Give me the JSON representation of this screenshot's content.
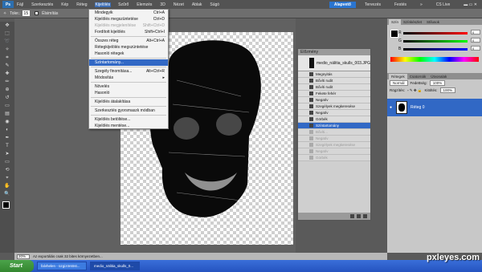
{
  "app": {
    "logo": "Ps"
  },
  "menubar": {
    "items": [
      "Fájl",
      "Szerkesztés",
      "Kép",
      "Réteg",
      "Kijelölés",
      "Szűrő",
      "Elemzés",
      "3D",
      "Nézet",
      "Ablak",
      "Súgó"
    ],
    "workspaces": [
      "Alapvető",
      "Tervezés",
      "Festés",
      "»"
    ],
    "cslive": "CS Live"
  },
  "options": {
    "tolerance_label": "Toler.:",
    "tolerance_value": "15",
    "smooth_label": "Élsimítás"
  },
  "dropdown": {
    "items": [
      {
        "label": "Mindegyik",
        "shortcut": "Ctrl+A",
        "disabled": false
      },
      {
        "label": "Kijelölés megszüntetése",
        "shortcut": "Ctrl+D",
        "disabled": false
      },
      {
        "label": "Kijelölés megjelenítése",
        "shortcut": "Shift+Ctrl+D",
        "disabled": true
      },
      {
        "label": "Fordított kijelölés",
        "shortcut": "Shift+Ctrl+I",
        "disabled": false
      },
      {
        "sep": true
      },
      {
        "label": "Összes réteg",
        "shortcut": "Alt+Ctrl+A",
        "disabled": false
      },
      {
        "label": "Rétegkijelölés megszüntetése",
        "shortcut": "",
        "disabled": false
      },
      {
        "label": "Hasonló rétegek",
        "shortcut": "",
        "disabled": false
      },
      {
        "sep": true
      },
      {
        "label": "Színtartomány...",
        "shortcut": "",
        "disabled": false,
        "selected": true
      },
      {
        "sep": true
      },
      {
        "label": "Szegély finomítása...",
        "shortcut": "Alt+Ctrl+R",
        "disabled": false
      },
      {
        "label": "Módosítás",
        "shortcut": "▸",
        "disabled": false
      },
      {
        "sep": true
      },
      {
        "label": "Növelés",
        "shortcut": "",
        "disabled": false
      },
      {
        "label": "Hasonló",
        "shortcut": "",
        "disabled": false
      },
      {
        "sep": true
      },
      {
        "label": "Kijelölés átalakítása",
        "shortcut": "",
        "disabled": false
      },
      {
        "sep": true
      },
      {
        "label": "Szerkesztés gyorsmaszk módban",
        "shortcut": "",
        "disabled": false
      },
      {
        "sep": true
      },
      {
        "label": "Kijelölés betöltése...",
        "shortcut": "",
        "disabled": false
      },
      {
        "label": "Kijelölés mentése...",
        "shortcut": "",
        "disabled": false
      }
    ]
  },
  "history": {
    "title": "Előzmény",
    "snapshot": "medio_nälitia_skulls_003.JPG",
    "rows": [
      {
        "label": "Megnyitás",
        "state": "done"
      },
      {
        "label": "Bővíti rudit",
        "state": "done"
      },
      {
        "label": "Bővíti rudit",
        "state": "done"
      },
      {
        "label": "Fekete fehér",
        "state": "done"
      },
      {
        "label": "Negatív",
        "state": "done"
      },
      {
        "label": "Szegélyek megkeresése",
        "state": "done"
      },
      {
        "label": "Negatív",
        "state": "done"
      },
      {
        "label": "Görbék",
        "state": "done"
      },
      {
        "label": "Színtartomány",
        "state": "current"
      },
      {
        "label": "Bővíti...",
        "state": "after"
      },
      {
        "label": "Negatív",
        "state": "after"
      },
      {
        "label": "Szegélyek megkeresése",
        "state": "after"
      },
      {
        "label": "Negatív",
        "state": "after"
      },
      {
        "label": "Görbék",
        "state": "after"
      }
    ]
  },
  "color_panel": {
    "tabs": [
      "Szín",
      "Színkészlet",
      "Stílusok"
    ],
    "r": {
      "label": "R",
      "value": "0"
    },
    "g": {
      "label": "G",
      "value": "0"
    },
    "b": {
      "label": "B",
      "value": "0"
    }
  },
  "layers_panel": {
    "tabs": [
      "Rétegek",
      "Csatornák",
      "Útvonalak"
    ],
    "blend_mode": "Normál",
    "opacity_label": "Fedettség:",
    "opacity_value": "100%",
    "lock_label": "Rögzítés:",
    "fill_label": "Kitöltés:",
    "fill_value": "100%",
    "layer_name": "Réteg 0"
  },
  "status": {
    "zoom": "20%",
    "text": "Az exportálás csak 32 bites környezetben..."
  },
  "taskbar": {
    "start": "Start",
    "tasks": [
      "falvhelen - üzgizöntöst...",
      "medio_nälitia_skulls_0..."
    ]
  },
  "watermark": "pxleyes.com"
}
